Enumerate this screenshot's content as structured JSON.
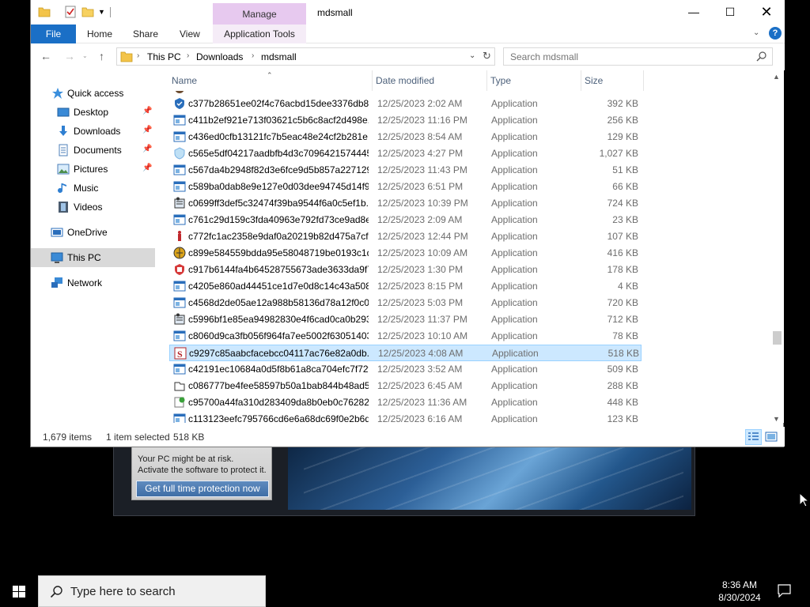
{
  "background_app": {
    "warning_line1": "Your PC might be at risk.",
    "warning_line2": "Activate the software to protect it.",
    "protect_button": "Get full time protection now"
  },
  "titlebar": {
    "contextual_tab": "Manage",
    "window_title": "mdsmall"
  },
  "ribbon": {
    "tabs": [
      {
        "label": "File"
      },
      {
        "label": "Home"
      },
      {
        "label": "Share"
      },
      {
        "label": "View"
      },
      {
        "label": "Application Tools"
      }
    ]
  },
  "address_bar": {
    "crumbs": [
      "This PC",
      "Downloads",
      "mdsmall"
    ]
  },
  "search": {
    "placeholder": "Search mdsmall"
  },
  "sidebar": {
    "items": [
      {
        "label": "Quick access",
        "icon": "star-icon"
      },
      {
        "label": "Desktop",
        "icon": "desktop-icon",
        "pinned": true
      },
      {
        "label": "Downloads",
        "icon": "download-arrow-icon",
        "pinned": true
      },
      {
        "label": "Documents",
        "icon": "documents-icon",
        "pinned": true
      },
      {
        "label": "Pictures",
        "icon": "pictures-icon",
        "pinned": true
      },
      {
        "label": "Music",
        "icon": "music-note-icon"
      },
      {
        "label": "Videos",
        "icon": "film-icon"
      },
      {
        "label": "OneDrive",
        "icon": "onedrive-icon"
      },
      {
        "label": "This PC",
        "icon": "computer-icon",
        "selected": true
      },
      {
        "label": "Network",
        "icon": "network-icon"
      }
    ]
  },
  "columns": {
    "name": "Name",
    "date": "Date modified",
    "type": "Type",
    "size": "Size"
  },
  "files": [
    {
      "name": "c377b28651ee02f4c76acbd15dee3376db8...",
      "date": "12/25/2023 2:02 AM",
      "type": "Application",
      "size": "392 KB",
      "icon": "shield-app-icon"
    },
    {
      "name": "c411b2ef921e713f03621c5b6c8acf2d498e...",
      "date": "12/25/2023 11:16 PM",
      "type": "Application",
      "size": "256 KB",
      "icon": "generic-exe-icon"
    },
    {
      "name": "c436ed0cfb13121fc7b5eac48e24cf2b281e...",
      "date": "12/25/2023 8:54 AM",
      "type": "Application",
      "size": "129 KB",
      "icon": "generic-exe-icon"
    },
    {
      "name": "c565e5df04217aadbfb4d3c7096421574445...",
      "date": "12/25/2023 4:27 PM",
      "type": "Application",
      "size": "1,027 KB",
      "icon": "light-shield-app-icon"
    },
    {
      "name": "c567da4b2948f82d3e6fce9d5b857a227129...",
      "date": "12/25/2023 11:43 PM",
      "type": "Application",
      "size": "51 KB",
      "icon": "generic-exe-icon"
    },
    {
      "name": "c589ba0dab8e9e127e0d03dee94745d14f9...",
      "date": "12/25/2023 6:51 PM",
      "type": "Application",
      "size": "66 KB",
      "icon": "generic-exe-icon"
    },
    {
      "name": "c0699ff3def5c32474f39ba9544f6a0c5ef1b...",
      "date": "12/25/2023 10:39 PM",
      "type": "Application",
      "size": "724 KB",
      "icon": "installer-icon"
    },
    {
      "name": "c761c29d159c3fda40963e792fd73ce9ad8e...",
      "date": "12/25/2023 2:09 AM",
      "type": "Application",
      "size": "23 KB",
      "icon": "generic-exe-icon"
    },
    {
      "name": "c772fc1ac2358e9daf0a20219b82d475a7cf...",
      "date": "12/25/2023 12:44 PM",
      "type": "Application",
      "size": "107 KB",
      "icon": "red-figure-icon"
    },
    {
      "name": "c899e584559bdda95e58048719be0193c1d...",
      "date": "12/25/2023 10:09 AM",
      "type": "Application",
      "size": "416 KB",
      "icon": "globe-app-icon"
    },
    {
      "name": "c917b6144fa4b64528755673ade3633da9f7...",
      "date": "12/25/2023 1:30 PM",
      "type": "Application",
      "size": "178 KB",
      "icon": "red-shield-icon"
    },
    {
      "name": "c4205e860ad44451ce1d7e0d8c14c43a508...",
      "date": "12/25/2023 8:15 PM",
      "type": "Application",
      "size": "4 KB",
      "icon": "generic-exe-icon"
    },
    {
      "name": "c4568d2de05ae12a988b58136d78a12f0c0...",
      "date": "12/25/2023 5:03 PM",
      "type": "Application",
      "size": "720 KB",
      "icon": "generic-exe-icon"
    },
    {
      "name": "c5996bf1e85ea94982830e4f6cad0ca0b293...",
      "date": "12/25/2023 11:37 PM",
      "type": "Application",
      "size": "712 KB",
      "icon": "installer-icon"
    },
    {
      "name": "c8060d9ca3fb056f964fa7ee5002f63051403...",
      "date": "12/25/2023 10:10 AM",
      "type": "Application",
      "size": "78 KB",
      "icon": "generic-exe-icon"
    },
    {
      "name": "c9297c85aabcfacebcc04117ac76e82a0db...",
      "date": "12/25/2023 4:08 AM",
      "type": "Application",
      "size": "518 KB",
      "icon": "red-s-icon",
      "selected": true
    },
    {
      "name": "c42191ec10684a0d5f8b61a8ca704efc7f72f...",
      "date": "12/25/2023 3:52 AM",
      "type": "Application",
      "size": "509 KB",
      "icon": "generic-exe-icon"
    },
    {
      "name": "c086777be4fee58597b50a1bab844b48ad5...",
      "date": "12/25/2023 6:45 AM",
      "type": "Application",
      "size": "288 KB",
      "icon": "shortcut-app-icon"
    },
    {
      "name": "c95700a44fa310d283409da8b0eb0c76282f...",
      "date": "12/25/2023 11:36 AM",
      "type": "Application",
      "size": "448 KB",
      "icon": "green-check-app-icon"
    },
    {
      "name": "c113123eefc795766cd6e6a68dc69f0e2b6d...",
      "date": "12/25/2023 6:16 AM",
      "type": "Application",
      "size": "123 KB",
      "icon": "generic-exe-icon"
    }
  ],
  "status_bar": {
    "item_count": "1,679 items",
    "selection": "1 item selected",
    "selection_size": "518 KB"
  },
  "taskbar": {
    "search_placeholder": "Type here to search",
    "time": "8:36 AM",
    "date": "8/30/2024"
  },
  "colors": {
    "accent": "#1a6fc6",
    "manage_tab": "#e7c9ef",
    "selection_bg": "#cce8ff",
    "selection_border": "#99d1ff"
  }
}
